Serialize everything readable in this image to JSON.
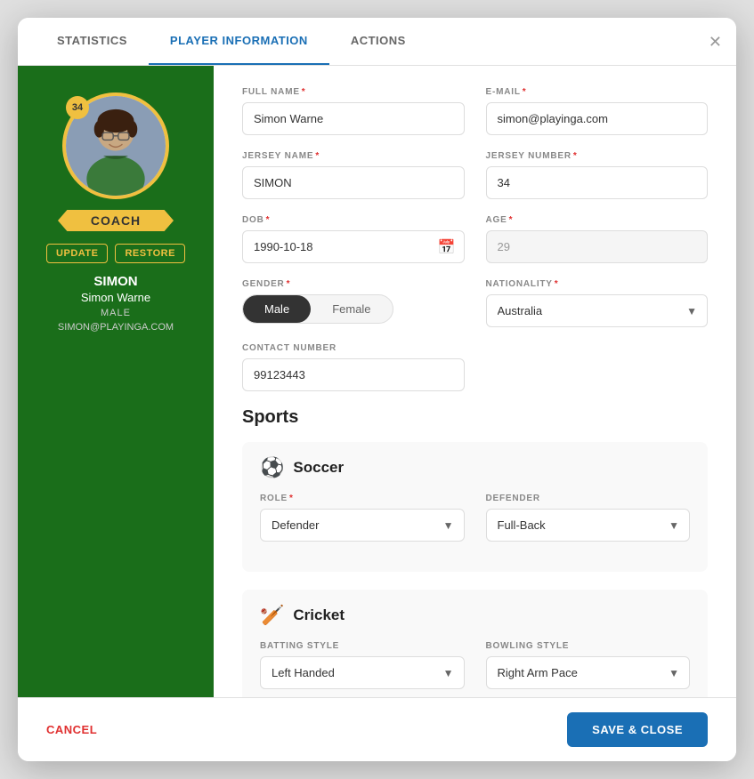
{
  "tabs": [
    {
      "id": "statistics",
      "label": "STATISTICS"
    },
    {
      "id": "player-information",
      "label": "PLAYER INFORMATION",
      "active": true
    },
    {
      "id": "actions",
      "label": "ACTIONS"
    }
  ],
  "sidebar": {
    "badge_number": "34",
    "role": "COACH",
    "update_btn": "UPDATE",
    "restore_btn": "RESTORE",
    "name": "SIMON",
    "full_name": "Simon Warne",
    "gender": "MALE",
    "email": "SIMON@PLAYINGA.COM"
  },
  "form": {
    "full_name_label": "FULL NAME",
    "full_name_value": "Simon Warne",
    "email_label": "E-MAIL",
    "email_value": "simon@playinga.com",
    "jersey_name_label": "JERSEY NAME",
    "jersey_name_value": "SIMON",
    "jersey_number_label": "JERSEY NUMBER",
    "jersey_number_value": "34",
    "dob_label": "DOB",
    "dob_value": "1990-10-18",
    "age_label": "AGE",
    "age_value": "29",
    "gender_label": "GENDER",
    "gender_male": "Male",
    "gender_female": "Female",
    "nationality_label": "NATIONALITY",
    "nationality_value": "Australia",
    "contact_label": "CONTACT NUMBER",
    "contact_value": "99123443"
  },
  "sports": {
    "section_title": "Sports",
    "soccer": {
      "name": "Soccer",
      "icon": "⚽",
      "role_label": "ROLE",
      "role_value": "Defender",
      "position_label": "DEFENDER",
      "position_value": "Full-Back"
    },
    "cricket": {
      "name": "Cricket",
      "icon": "🏏",
      "batting_label": "BATTING STYLE",
      "batting_value": "Left Handed",
      "bowling_label": "BOWLING STYLE",
      "bowling_value": "Right Arm Pace"
    }
  },
  "footer": {
    "cancel_label": "CANCEL",
    "save_close_label": "SAVE & CLOSE"
  }
}
